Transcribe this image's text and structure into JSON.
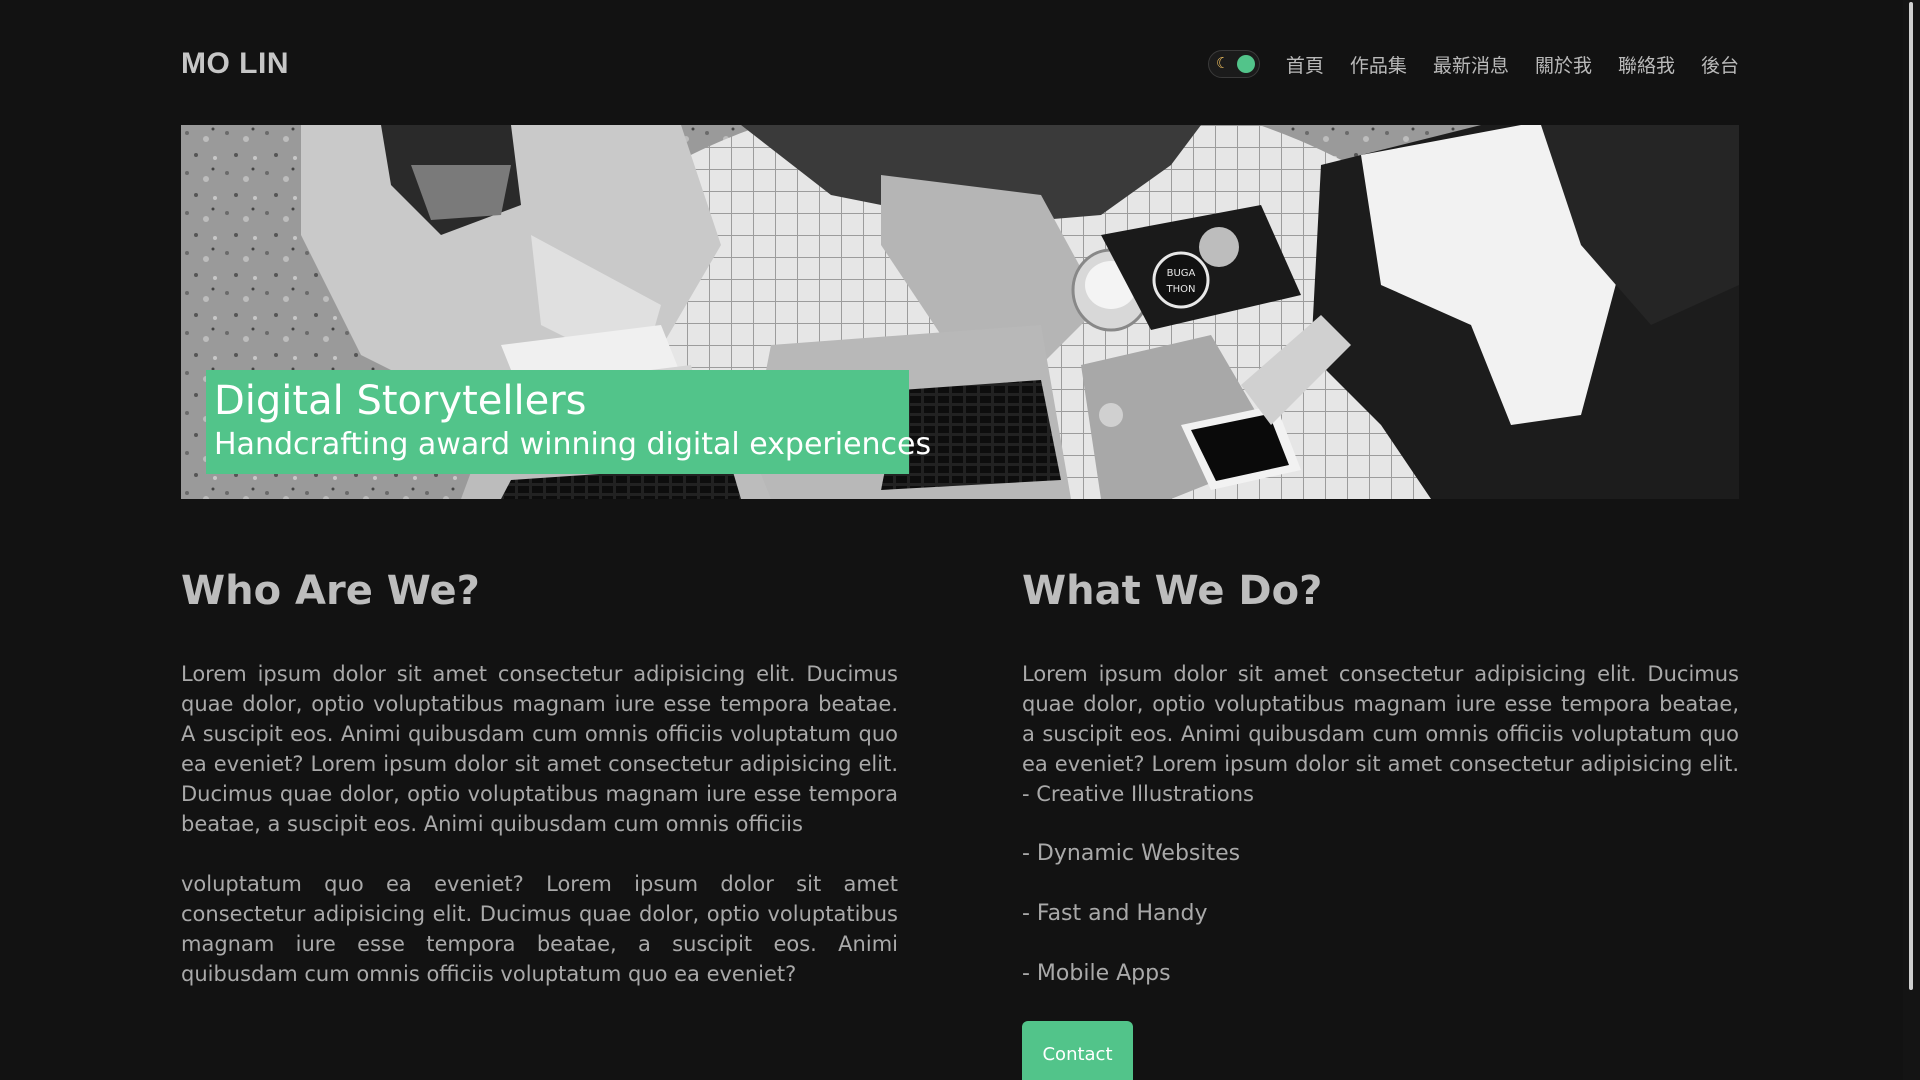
{
  "header": {
    "brand": "MO LIN",
    "nav": [
      "首頁",
      "作品集",
      "最新消息",
      "關於我",
      "聯絡我",
      "後台"
    ]
  },
  "theme_toggle": {
    "moon_glyph": "☾",
    "icon": "moon-icon"
  },
  "hero": {
    "title": "Digital Storytellers",
    "subtitle": "Handcrafting award winning digital experiences",
    "badge_text": "BUGA THON"
  },
  "who": {
    "heading": "Who Are We?",
    "paragraphs": [
      "Lorem ipsum dolor sit amet consectetur adipisicing elit. Ducimus quae dolor, optio voluptatibus magnam iure esse tempora beatae. A suscipit eos. Animi quibusdam cum omnis officiis voluptatum quo ea eveniet? Lorem ipsum dolor sit amet consectetur adipisicing elit. Ducimus quae dolor, optio voluptatibus magnam iure esse tempora beatae, a suscipit eos. Animi quibusdam cum omnis officiis",
      "voluptatum quo ea eveniet? Lorem ipsum dolor sit amet consectetur adipisicing elit. Ducimus quae dolor, optio voluptatibus magnam iure esse tempora beatae, a suscipit eos. Animi quibusdam cum omnis officiis voluptatum quo ea eveniet?"
    ]
  },
  "what": {
    "heading": "What We Do?",
    "paragraph": "Lorem ipsum dolor sit amet consectetur adipisicing elit. Ducimus quae dolor, optio voluptatibus magnam iure esse tempora beatae, a suscipit eos. Animi quibusdam cum omnis officiis voluptatum quo ea eveniet? Lorem ipsum dolor sit amet consectetur adipisicing elit. - Creative Illustrations",
    "items": [
      "- Dynamic Websites",
      "- Fast and Handy",
      "- Mobile Apps"
    ],
    "contact_label": "Contact"
  },
  "colors": {
    "background": "#121212",
    "accent": "#52c48a",
    "text": "#a9a9a9"
  }
}
